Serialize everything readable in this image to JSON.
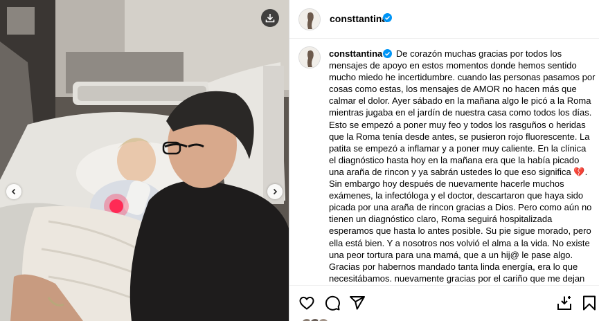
{
  "photo": {
    "download_icon": "download-icon",
    "prev_icon": "chevron-left-icon",
    "next_icon": "chevron-right-icon"
  },
  "header": {
    "username": "consttantina",
    "verified_icon": "verified-badge-icon"
  },
  "caption": {
    "username": "consttantina",
    "text_part1": " De corazón muchas gracias por todos los mensajes de apoyo en estos momentos donde hemos sentido mucho miedo he incertidumbre. cuando las personas pasamos por cosas como estas, los mensajes de AMOR no hacen más que calmar el dolor. Ayer sábado en la mañana algo le picó a la Roma mientras jugaba en el jardín de nuestra casa como todos los días. Esto se empezó a poner muy feo y todos los rasguños o heridas que la Roma tenía desde antes, se pusieron rojo fluorescente. La patita se empezó a inflamar y a poner muy caliente. En la clínica el diagnóstico hasta hoy en la mañana era que la había picado una araña de rincon y ya sabrán ustedes lo que eso significa ",
    "emoji": "💔",
    "text_part2": ". Sin embargo hoy después de nuevamente hacerle muchos exámenes, la infectóloga y el doctor, descartaron que haya sido picada por una araña de rincon gracias a Dios. Pero como aún no tienen un diagnóstico claro, Roma seguirá hospitalizada esperamos que hasta lo antes posible. Su pie sigue morado, pero ella está bien. Y a nosotros nos volvió el alma a la vida. No existe una peor tortura para una mamá, que a un hij@ le pase algo. Gracias por habernos mandado tanta linda energía, era lo que necesitábamos. nuevamente gracias por el cariño que me dejan siempre en sus mensajes."
  },
  "actions": {
    "like_icon": "heart-icon",
    "comment_icon": "comment-icon",
    "share_icon": "share-icon",
    "repost_icon": "repost-icon",
    "save_icon": "bookmark-icon"
  },
  "colors": {
    "verified": "#0095f6",
    "border": "#dbdbdb",
    "text": "#000000"
  }
}
